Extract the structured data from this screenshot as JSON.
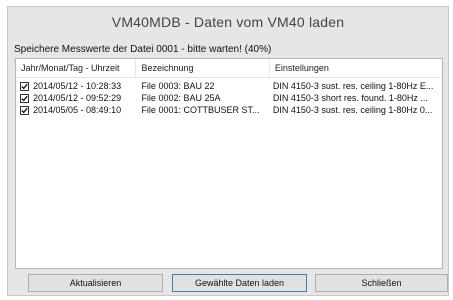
{
  "window": {
    "title": "VM40MDB - Daten vom VM40 laden"
  },
  "status_text": "Speichere Messwerte der Datei 0001 - bitte warten! (40%)",
  "progress_percent": 40,
  "table": {
    "columns": [
      "Jahr/Monat/Tag - Uhrzeit",
      "Bezeichnung",
      "Einstellungen"
    ],
    "rows": [
      {
        "checked": true,
        "datetime": "2014/05/12 - 10:28:33",
        "name": "File 0003: BAU 22",
        "settings": "DIN 4150-3  sust. res. ceiling   1-80Hz  E..."
      },
      {
        "checked": true,
        "datetime": "2014/05/12 - 09:52:29",
        "name": "File 0002: BAU 25A",
        "settings": "DIN 4150-3  short res. found.    1-80Hz  ..."
      },
      {
        "checked": true,
        "datetime": "2014/05/05 - 08:49:10",
        "name": "File 0001: COTTBUSER ST...",
        "settings": "DIN 4150-3 sust. res. ceiling  1-80Hz  0..."
      }
    ]
  },
  "buttons": {
    "refresh": "Aktualisieren",
    "load_selected": "Gewählte Daten laden",
    "close": "Schließen"
  }
}
